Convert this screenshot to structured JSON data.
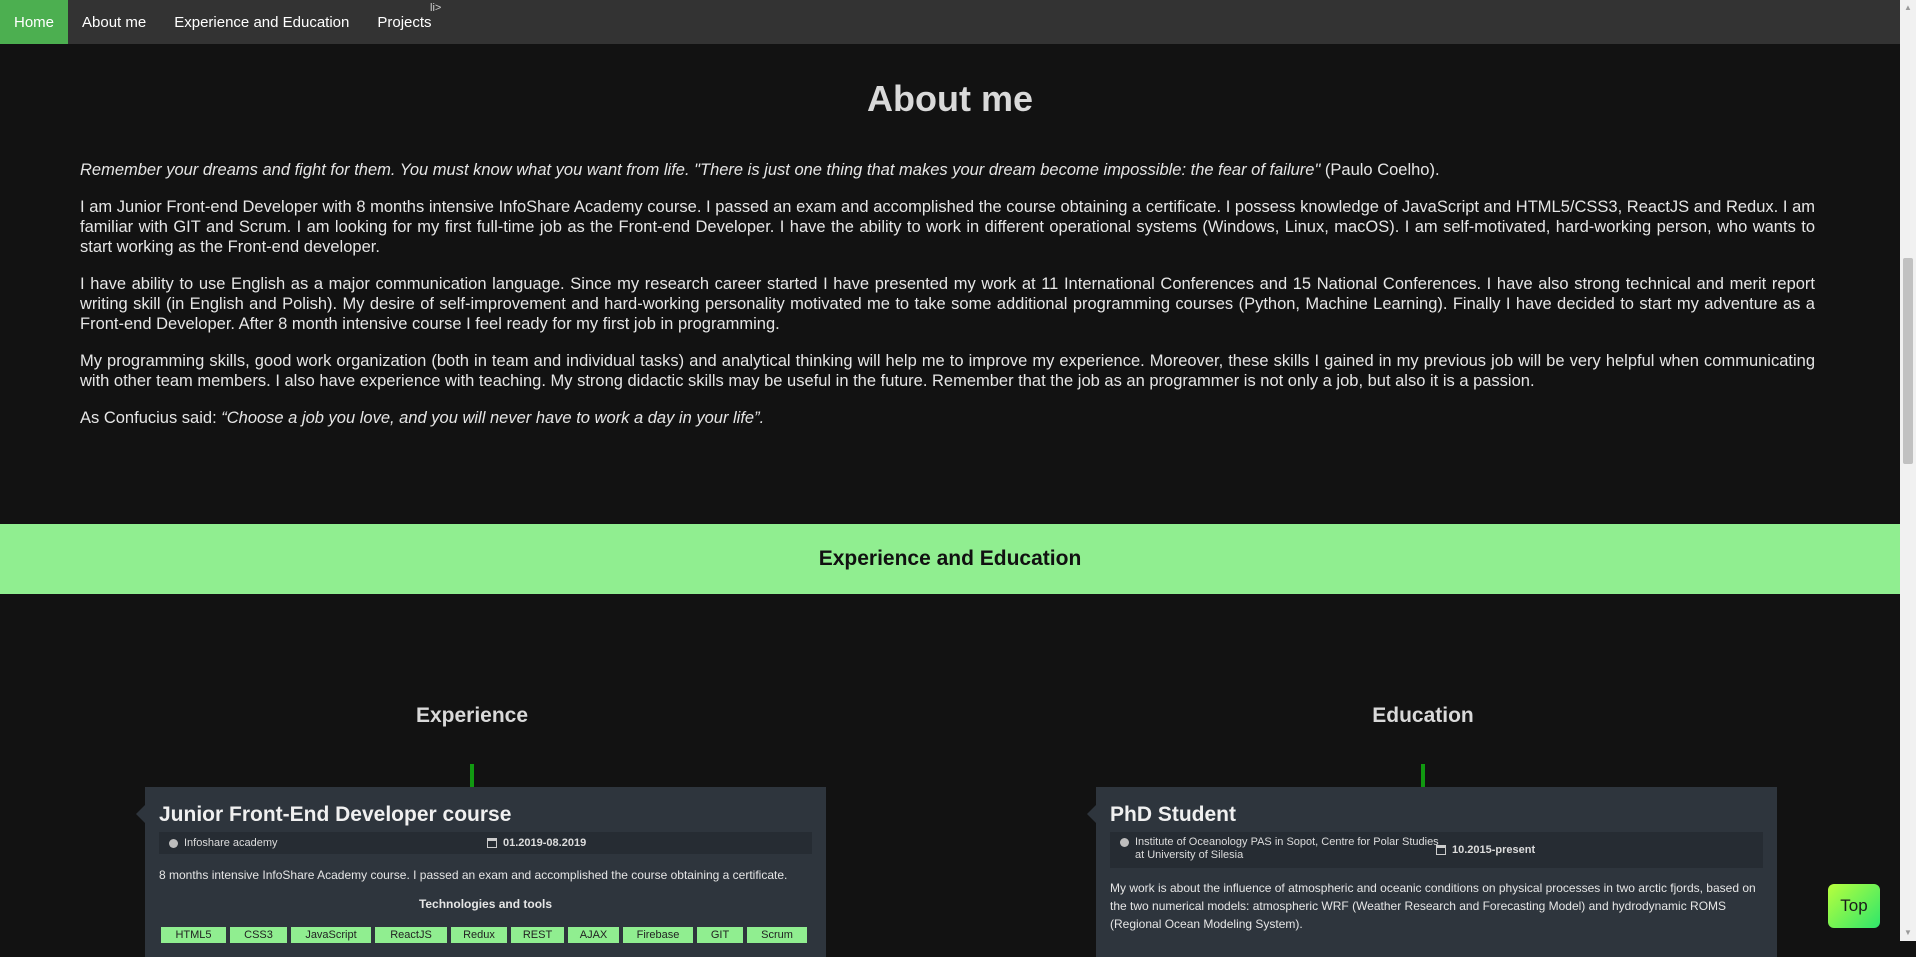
{
  "nav": {
    "items": [
      "Home",
      "About me",
      "Experience and Education",
      "Projects"
    ],
    "stray_text": "li>"
  },
  "about": {
    "title": "About me",
    "quote_italic": "Remember your dreams and fight for them. You must know what you want from life. \"There is just one thing that makes your dream become impossible: the fear of failure\"",
    "quote_author": " (Paulo Coelho).",
    "p1": "I am Junior Front-end Developer with 8 months intensive InfoShare Academy course. I passed an exam and accomplished the course obtaining a certificate. I possess knowledge of JavaScript and HTML5/CSS3, ReactJS and Redux. I am familiar with GIT and Scrum. I am looking for my first full-time job as the Front-end Developer. I have the ability to work in different operational systems (Windows, Linux, macOS). I am self-motivated, hard-working person, who wants to start working as the Front-end developer.",
    "p2": "I have ability to use English as a major communication language. Since my research career started I have presented my work at 11 International Conferences and 15 National Conferences. I have also strong technical and merit report writing skill (in English and Polish). My desire of self-improvement and hard-working personality motivated me to take some additional programming courses (Python, Machine Learning). Finally I have decided to start my adventure as a Front-end Developer. After 8 month intensive course I feel ready for my first job in programming.",
    "p3": "My programming skills, good work organization (both in team and individual tasks) and analytical thinking will help me to improve my experience. Moreover, these skills I gained in my previous job will be very helpful when communicating with other team members. I also have experience with teaching. My strong didactic skills may be useful in the future. Remember that the job as an programmer is not only a job, but also it is a passion.",
    "confucius_prefix": "As Confucius said: ",
    "confucius_quote": "“Choose a job you love, and you will never have to work a day in your life”."
  },
  "band": {
    "title": "Experience and Education"
  },
  "experience": {
    "title": "Experience",
    "card": {
      "title": "Junior Front-End Developer course",
      "place": "Infoshare academy",
      "date": "01.2019-08.2019",
      "desc": "8 months intensive InfoShare Academy course. I passed an exam and accomplished the course obtaining a certificate.",
      "tools_title": "Technologies and tools",
      "tags": [
        "HTML5",
        "CSS3",
        "JavaScript",
        "ReactJS",
        "Redux",
        "REST",
        "AJAX",
        "Firebase",
        "GIT",
        "Scrum"
      ]
    }
  },
  "education": {
    "title": "Education",
    "card": {
      "title": "PhD Student",
      "place_line1": "Institute of Oceanology PAS in Sopot, Centre for Polar Studies",
      "place_line2": "at University of Silesia",
      "date": "10.2015-present",
      "desc": "My work is about the influence of atmospheric and oceanic conditions on physical processes in two arctic fjords, based on the two numerical models: atmospheric WRF (Weather Research and Forecasting Model) and hydrodynamic ROMS (Regional Ocean Modeling System)."
    }
  },
  "top_button": {
    "label": "Top"
  },
  "colors": {
    "nav_active": "#4caf50",
    "band": "#90ee90",
    "tag": "#90ee90",
    "card": "#2e353d",
    "timeline": "#119911"
  }
}
